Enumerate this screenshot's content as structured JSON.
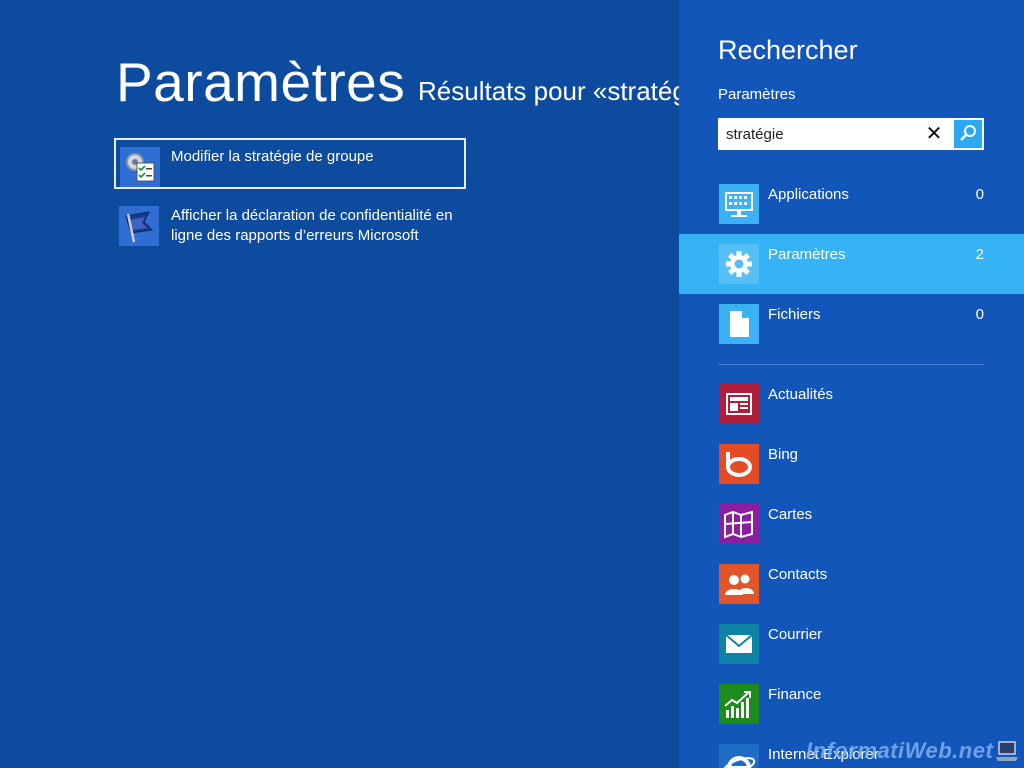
{
  "main": {
    "title": "Paramètres",
    "results_for": "Résultats pour «stratég",
    "results": [
      {
        "label": "Modifier la stratégie de groupe",
        "icon": "group-policy-icon"
      },
      {
        "label": "Afficher la déclaration de confidentialité en ligne des rapports d’erreurs Microsoft",
        "icon": "flag-icon"
      }
    ]
  },
  "search_pane": {
    "title": "Rechercher",
    "scope": "Paramètres",
    "query": "stratégie",
    "categories": [
      {
        "label": "Applications",
        "count": "0",
        "icon": "applications-icon"
      },
      {
        "label": "Paramètres",
        "count": "2",
        "icon": "settings-gear-icon",
        "active": true
      },
      {
        "label": "Fichiers",
        "count": "0",
        "icon": "file-icon"
      }
    ],
    "apps": [
      {
        "label": "Actualités",
        "color": "#b01e3b",
        "icon": "news-icon"
      },
      {
        "label": "Bing",
        "color": "#e54b24",
        "icon": "bing-icon"
      },
      {
        "label": "Cartes",
        "color": "#8c1fa0",
        "icon": "maps-icon"
      },
      {
        "label": "Contacts",
        "color": "#e0562a",
        "icon": "contacts-icon"
      },
      {
        "label": "Courrier",
        "color": "#0e83a3",
        "icon": "mail-icon"
      },
      {
        "label": "Finance",
        "color": "#1e8b1d",
        "icon": "finance-icon"
      },
      {
        "label": "Internet Explorer",
        "color": "#1e6ec8",
        "icon": "internet-explorer-icon"
      }
    ]
  },
  "watermark": "InformatiWeb.net",
  "colors": {
    "background": "#0d4b9f",
    "pane": "#1356b9",
    "active": "#35b3f4"
  }
}
